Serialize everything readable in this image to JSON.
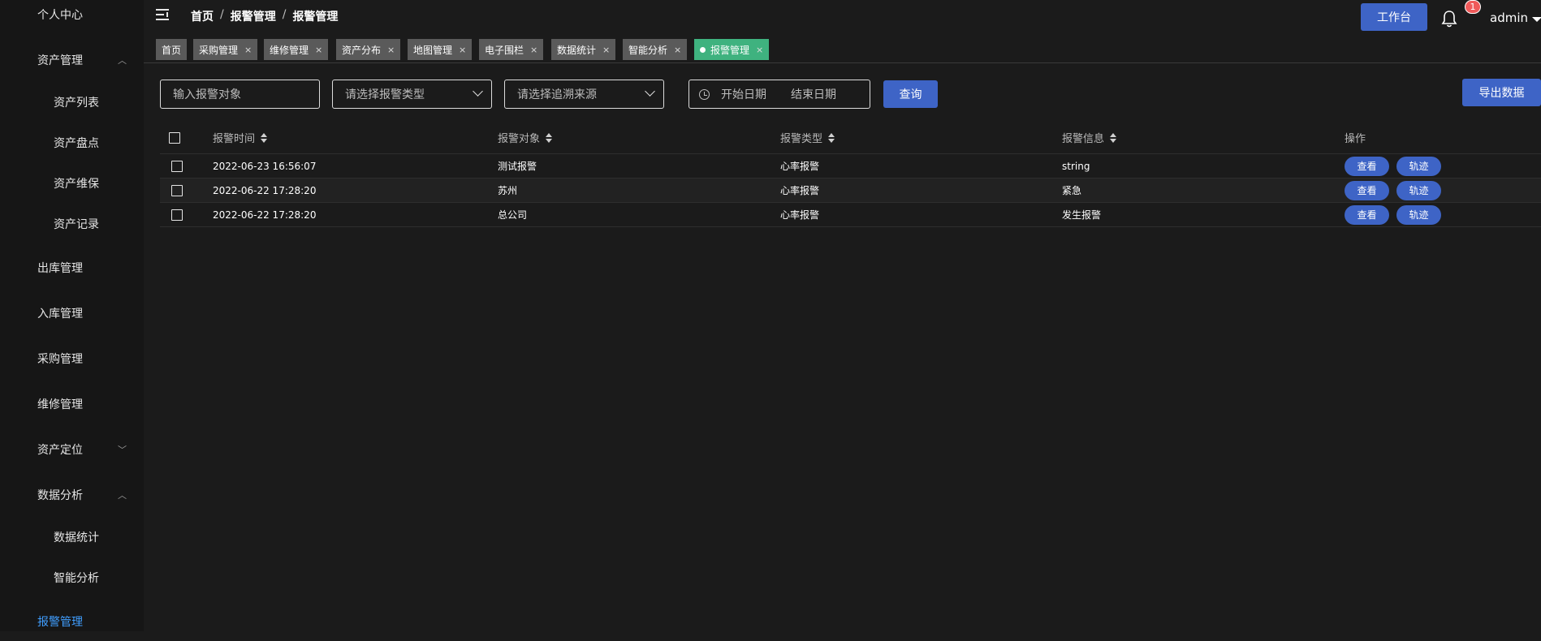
{
  "sidebar": {
    "items": [
      {
        "label": "个人中心"
      },
      {
        "label": "资产管理"
      },
      {
        "label": "资产列表"
      },
      {
        "label": "资产盘点"
      },
      {
        "label": "资产维保"
      },
      {
        "label": "资产记录"
      },
      {
        "label": "出库管理"
      },
      {
        "label": "入库管理"
      },
      {
        "label": "采购管理"
      },
      {
        "label": "维修管理"
      },
      {
        "label": "资产定位"
      },
      {
        "label": "数据分析"
      },
      {
        "label": "数据统计"
      },
      {
        "label": "智能分析"
      },
      {
        "label": "报警管理"
      }
    ],
    "active_color": "#409eff"
  },
  "header": {
    "breadcrumb": [
      "首页",
      "报警管理",
      "报警管理"
    ],
    "separator": "/",
    "workbench_label": "工作台",
    "notification_count": "1",
    "user_name": "admin"
  },
  "tags": [
    {
      "label": "首页"
    },
    {
      "label": "采购管理",
      "close": "×"
    },
    {
      "label": "维修管理",
      "close": "×"
    },
    {
      "label": "资产分布",
      "close": "×"
    },
    {
      "label": "地图管理",
      "close": "×"
    },
    {
      "label": "电子围栏",
      "close": "×"
    },
    {
      "label": "数据统计",
      "close": "×"
    },
    {
      "label": "智能分析",
      "close": "×"
    },
    {
      "label": "报警管理",
      "close": "×"
    }
  ],
  "filters": {
    "target_placeholder": "输入报警对象",
    "type_placeholder": "请选择报警类型",
    "source_placeholder": "请选择追溯来源",
    "start_date_placeholder": "开始日期",
    "end_date_placeholder": "结束日期",
    "query_label": "查询",
    "export_label": "导出数据"
  },
  "table": {
    "headers": [
      "报警时间",
      "报警对象",
      "报警类型",
      "报警信息",
      "操作"
    ],
    "rows": [
      {
        "time": "2022-06-23 16:56:07",
        "target": "测试报警",
        "type": "心率报警",
        "info": "string"
      },
      {
        "time": "2022-06-22 17:28:20",
        "target": "苏州",
        "type": "心率报警",
        "info": "紧急"
      },
      {
        "time": "2022-06-22 17:28:20",
        "target": "总公司",
        "type": "心率报警",
        "info": "发生报警"
      }
    ],
    "view_label": "查看",
    "track_label": "轨迹"
  },
  "colors": {
    "primary": "#3e64c6",
    "active_tag": "#3fb27f",
    "badge": "#f05a5a"
  }
}
